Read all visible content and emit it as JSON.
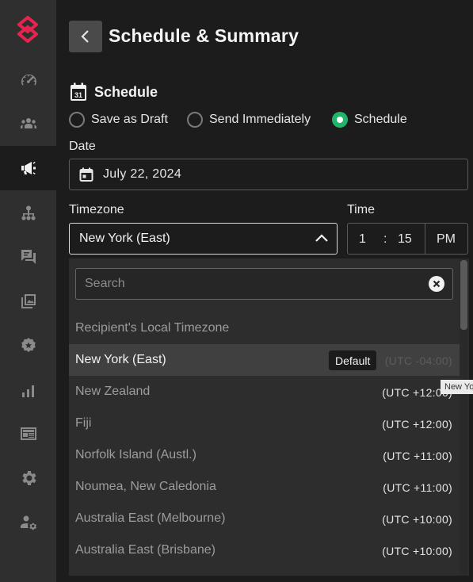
{
  "header": {
    "title": "Schedule & Summary"
  },
  "section": {
    "title": "Schedule",
    "calendar_day": "31"
  },
  "delivery_options": [
    {
      "label": "Save as Draft",
      "checked": false
    },
    {
      "label": "Send Immediately",
      "checked": false
    },
    {
      "label": "Schedule",
      "checked": true
    }
  ],
  "date": {
    "label": "Date",
    "value": "July 22, 2024"
  },
  "timezone": {
    "label": "Timezone",
    "value": "New York (East)"
  },
  "time": {
    "label": "Time",
    "hour": "1",
    "separator": ":",
    "minute": "15",
    "period": "PM"
  },
  "search": {
    "placeholder": "Search"
  },
  "timezone_options": [
    {
      "name": "Recipient's Local Timezone",
      "utc": ""
    },
    {
      "name": "New York (East)",
      "utc": "(UTC -04:00)",
      "badge": "Default",
      "selected": true
    },
    {
      "name": "New Zealand",
      "utc": "(UTC +12:00)"
    },
    {
      "name": "Fiji",
      "utc": "(UTC +12:00)"
    },
    {
      "name": "Norfolk Island (Austl.)",
      "utc": "(UTC +11:00)"
    },
    {
      "name": "Noumea, New Caledonia",
      "utc": "(UTC +11:00)"
    },
    {
      "name": "Australia East (Melbourne)",
      "utc": "(UTC +10:00)"
    },
    {
      "name": "Australia East (Brisbane)",
      "utc": "(UTC +10:00)"
    }
  ],
  "tooltip": {
    "text": "New York (East)"
  },
  "colors": {
    "accent": "#1fb56a",
    "brand": "#e8234f",
    "background": "#1c1c1c",
    "sidebar": "#2f2f2f"
  },
  "sidebar_icons": [
    "dashboard-icon",
    "audience-icon",
    "campaigns-icon",
    "hierarchy-icon",
    "chat-icon",
    "media-icon",
    "badge-icon",
    "analytics-icon",
    "newsletter-icon",
    "settings-icon",
    "admin-settings-icon"
  ]
}
